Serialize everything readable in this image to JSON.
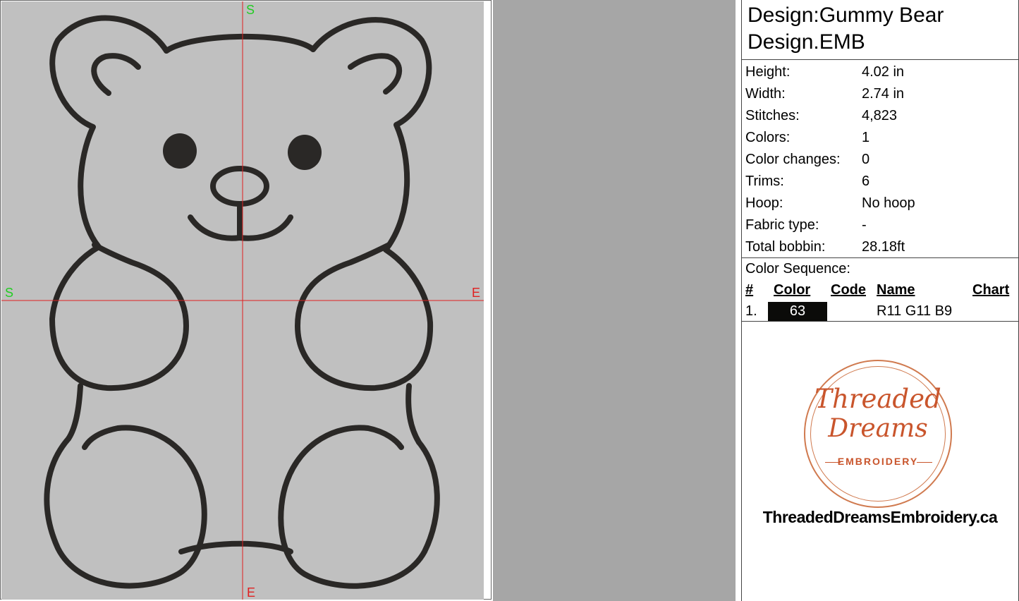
{
  "design": {
    "title_line1": "Design:Gummy Bear",
    "title_line2": "Design.EMB"
  },
  "properties": [
    {
      "label": "Height:",
      "value": "4.02 in"
    },
    {
      "label": "Width:",
      "value": "2.74 in"
    },
    {
      "label": "Stitches:",
      "value": "4,823"
    },
    {
      "label": "Colors:",
      "value": "1"
    },
    {
      "label": "Color changes:",
      "value": "0"
    },
    {
      "label": "Trims:",
      "value": "6"
    },
    {
      "label": "Hoop:",
      "value": "No hoop"
    },
    {
      "label": "Fabric type:",
      "value": "-"
    },
    {
      "label": "Total bobbin:",
      "value": "28.18ft"
    }
  ],
  "color_sequence": {
    "title": "Color Sequence:",
    "headers": {
      "num": "#",
      "color": "Color",
      "code": "Code",
      "name": "Name",
      "chart": "Chart"
    },
    "rows": [
      {
        "num": "1.",
        "color_label": "63",
        "swatch_hex": "#0b0b09",
        "code": "",
        "name": "R11 G11 B9",
        "chart": ""
      }
    ]
  },
  "axis_labels": {
    "top": "S",
    "bottom": "E",
    "left": "S",
    "right": "E"
  },
  "logo": {
    "line1": "Threaded",
    "line2": "Dreams",
    "line3": "EMBROIDERY",
    "website": "ThreadedDreamsEmbroidery.ca"
  },
  "colors": {
    "canvas_bg": "#c0c0c0",
    "stitch": "#2a2826",
    "crosshair": "#e02020",
    "axis_label": "#22cc22",
    "brand": "#c9552c"
  }
}
